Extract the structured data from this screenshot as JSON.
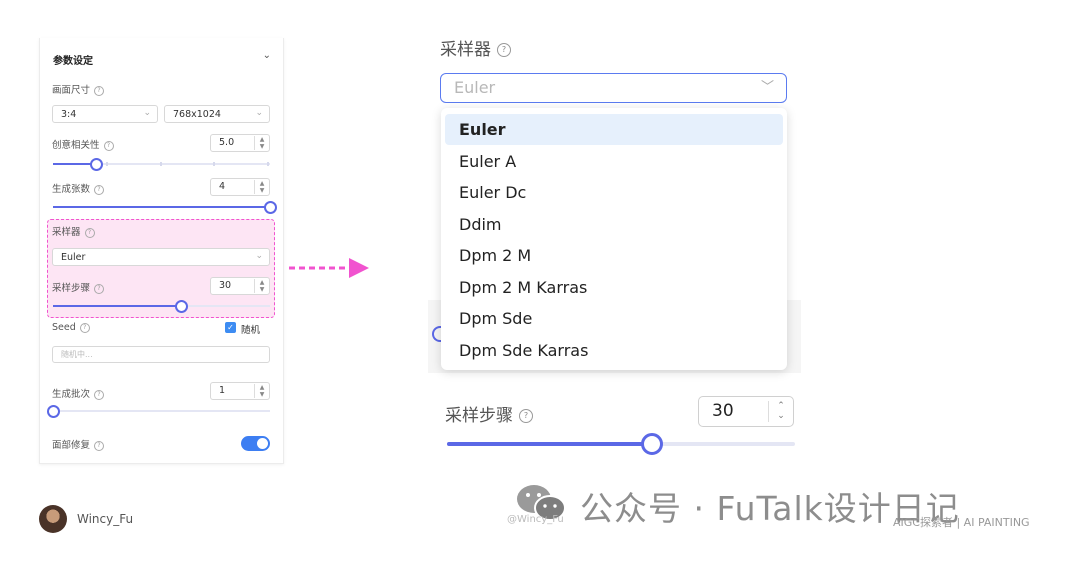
{
  "left_panel": {
    "title": "参数设定",
    "size_label": "画面尺寸",
    "ratio_value": "3:4",
    "resolution_value": "768x1024",
    "cfg_label": "创意相关性",
    "cfg_value": "5.0",
    "cfg_slider": 0.2,
    "count_label": "生成张数",
    "count_value": "4",
    "count_slider": 1.0,
    "sampler_label": "采样器",
    "sampler_value": "Euler",
    "steps_label": "采样步骤",
    "steps_value": "30",
    "steps_slider": 0.59,
    "seed_label": "Seed",
    "random_label": "随机",
    "seed_placeholder": "随机中...",
    "batch_label": "生成批次",
    "batch_value": "1",
    "batch_slider": 0.0,
    "face_fix_label": "面部修复",
    "face_fix_on": true
  },
  "zoom": {
    "sampler_label": "采样器",
    "placeholder": "Euler",
    "options": [
      "Euler",
      "Euler A",
      "Euler Dc",
      "Ddim",
      "Dpm 2 M",
      "Dpm 2 M Karras",
      "Dpm Sde",
      "Dpm Sde Karras"
    ],
    "selected_index": 0,
    "steps_label": "采样步骤",
    "steps_value": "30",
    "steps_slider": 0.59
  },
  "footer": {
    "author": "Wincy_Fu",
    "watermark_small": "@Wincy_Fu",
    "watermark_big": "公众号 · FuTalk设计日记",
    "watermark_right": "AIGC探索者 | AI PAINTING"
  },
  "colors": {
    "accent": "#5b68e6",
    "highlight_border": "#f153cf",
    "highlight_bg": "#fde5f4",
    "toggle": "#3d7ef2"
  }
}
